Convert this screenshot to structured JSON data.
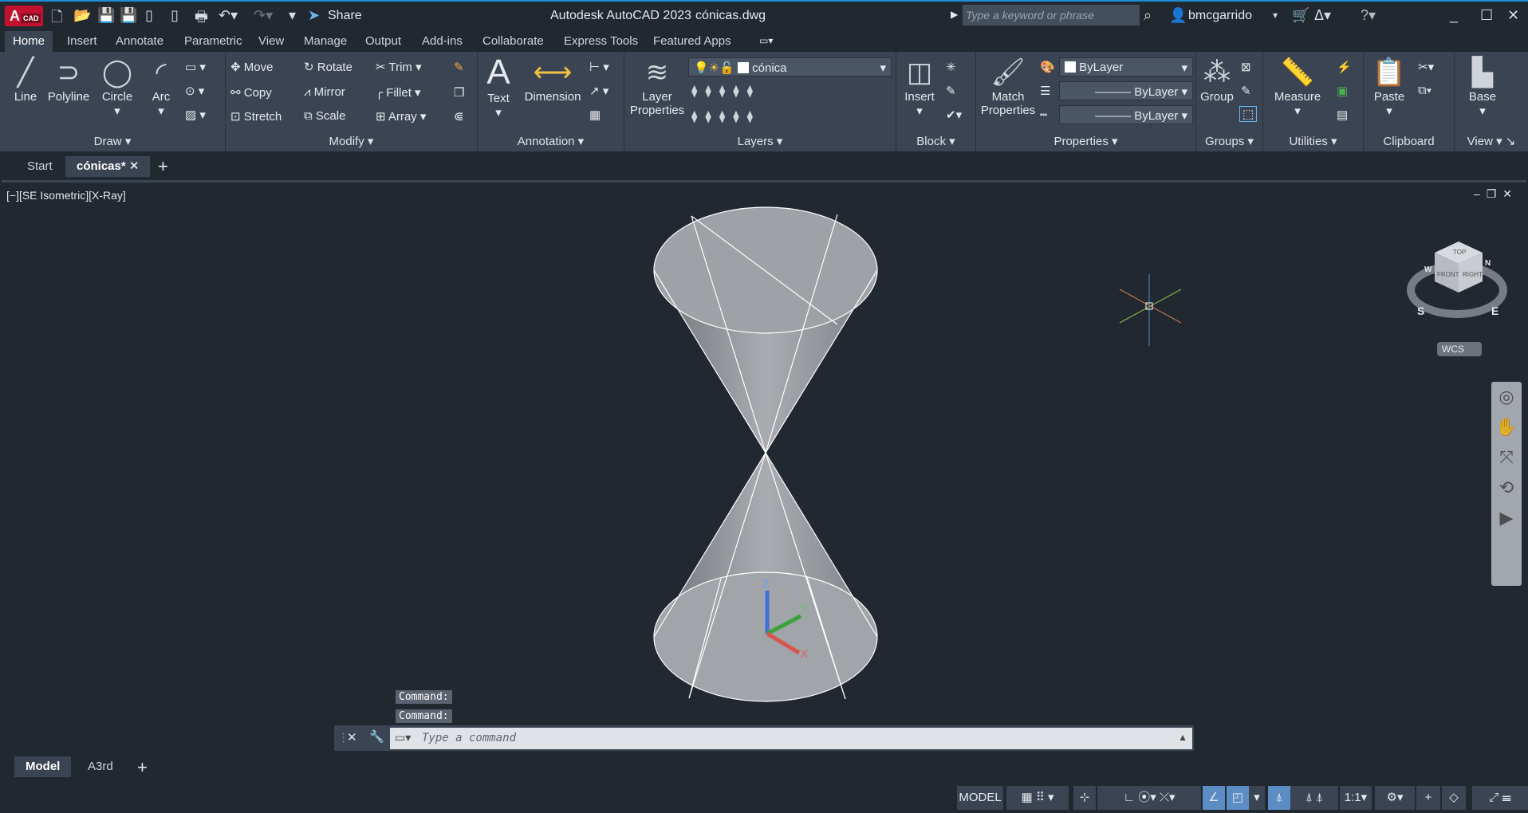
{
  "app": {
    "logo": "A",
    "logo_sub": "CAD",
    "title": "Autodesk AutoCAD 2023",
    "file": "cónicas.dwg",
    "share": "Share",
    "search_placeholder": "Type a keyword or phrase",
    "user": "bmcgarrido"
  },
  "ribbon_tabs": [
    "Home",
    "Insert",
    "Annotate",
    "Parametric",
    "View",
    "Manage",
    "Output",
    "Add-ins",
    "Collaborate",
    "Express Tools",
    "Featured Apps"
  ],
  "panels": {
    "draw": {
      "label": "Draw",
      "line": "Line",
      "polyline": "Polyline",
      "circle": "Circle",
      "arc": "Arc"
    },
    "modify": {
      "label": "Modify",
      "move": "Move",
      "rotate": "Rotate",
      "trim": "Trim",
      "copy": "Copy",
      "mirror": "Mirror",
      "fillet": "Fillet",
      "stretch": "Stretch",
      "scale": "Scale",
      "array": "Array"
    },
    "annotation": {
      "label": "Annotation",
      "text": "Text",
      "dimension": "Dimension"
    },
    "layers": {
      "label": "Layers",
      "layer_props_1": "Layer",
      "layer_props_2": "Properties",
      "current_layer": "cónica"
    },
    "block": {
      "label": "Block",
      "insert": "Insert"
    },
    "properties": {
      "label": "Properties",
      "match_1": "Match",
      "match_2": "Properties",
      "color": "ByLayer",
      "linetype": "ByLayer",
      "lineweight": "ByLayer"
    },
    "groups": {
      "label": "Groups",
      "group": "Group"
    },
    "utilities": {
      "label": "Utilities",
      "measure": "Measure"
    },
    "clipboard": {
      "label": "Clipboard",
      "paste": "Paste"
    },
    "view": {
      "label": "View",
      "base": "Base"
    }
  },
  "file_tabs": {
    "start": "Start",
    "current": "cónicas*"
  },
  "viewport": {
    "label": "[−][SE Isometric][X-Ray]",
    "viewcube": {
      "top": "TOP",
      "front": "FRONT",
      "right": "RIGHT",
      "s": "S",
      "e": "E",
      "w": "W",
      "n": "N",
      "wcs": "WCS"
    },
    "ucs": {
      "x": "X",
      "y": "Y",
      "z": "Z"
    }
  },
  "command": {
    "history": [
      "Command:",
      "Command:"
    ],
    "placeholder": "Type a command"
  },
  "layout_tabs": [
    "Model",
    "A3rd"
  ],
  "status": {
    "model": "MODEL",
    "scale": "1:1"
  }
}
